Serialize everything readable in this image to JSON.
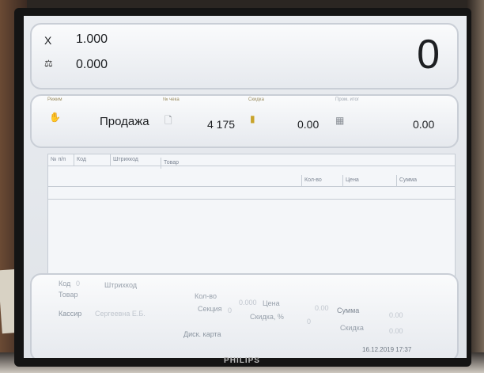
{
  "header": {
    "multiplier": "1.000",
    "weight": "0.000",
    "total": "0",
    "x_label": "X"
  },
  "info": {
    "mode_label": "Режим",
    "mode_value": "Продажа",
    "check_label": "№ чека",
    "check_value": "4 175",
    "discount_label": "Скидка",
    "discount_value": "0.00",
    "subtotal_label": "Пром. итог",
    "subtotal_value": "0.00"
  },
  "table": {
    "columns": [
      "№ п/п",
      "Код",
      "Штрихкод",
      "Товар"
    ],
    "columns_right": [
      "Кол-во",
      "Цена",
      "Сумма"
    ]
  },
  "details": {
    "code_label": "Код",
    "code_value": "0",
    "barcode_label": "Штрихкод",
    "product_label": "Товар",
    "qty_label": "Кол-во",
    "qty_value": "0.000",
    "price_label": "Цена",
    "price_value": "0.00",
    "sum_label": "Сумма",
    "sum_value": "0.00",
    "section_label": "Секция",
    "section_value": "0",
    "discount_pct_label": "Скидка, %",
    "discount_pct_value": "0",
    "discount_label": "Скидка",
    "discount_value": "0.00",
    "cashier_label": "Кассир",
    "cashier_value": "Сергеевна Е.Б.",
    "card_label": "Диск. карта"
  },
  "status": {
    "datetime": "16.12.2019 17:37"
  },
  "monitor": {
    "brand": "PHILIPS"
  }
}
